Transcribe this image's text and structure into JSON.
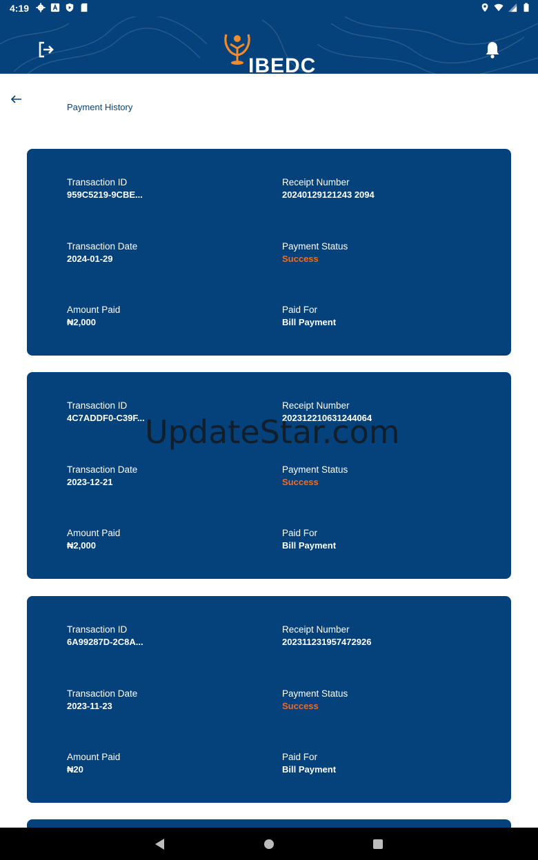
{
  "status_bar": {
    "time": "4:19"
  },
  "header": {
    "logo_text": "IBEDC"
  },
  "page": {
    "title": "Payment History"
  },
  "labels": {
    "transaction_id": "Transaction ID",
    "receipt_number": "Receipt Number",
    "transaction_date": "Transaction Date",
    "payment_status": "Payment Status",
    "amount_paid": "Amount Paid",
    "paid_for": "Paid For"
  },
  "payments": [
    {
      "transaction_id": "959C5219-9CBE...",
      "receipt_number": "20240129121243 2094",
      "transaction_date": "2024-01-29",
      "payment_status": "Success",
      "amount_paid": "₦2,000",
      "paid_for": "Bill Payment"
    },
    {
      "transaction_id": "4C7ADDF0-C39F...",
      "receipt_number": "202312210631244064",
      "transaction_date": "2023-12-21",
      "payment_status": "Success",
      "amount_paid": "₦2,000",
      "paid_for": "Bill Payment"
    },
    {
      "transaction_id": "6A99287D-2C8A...",
      "receipt_number": "202311231957472926",
      "transaction_date": "2023-11-23",
      "payment_status": "Success",
      "amount_paid": "₦20",
      "paid_for": "Bill Payment"
    }
  ],
  "watermark": "UpdateStar.com",
  "icons": {
    "logout": "logout-icon",
    "bell": "bell-icon",
    "back": "arrow-left-icon"
  },
  "colors": {
    "primary": "#05417a",
    "success": "#f26a21",
    "background": "#ffffff"
  }
}
